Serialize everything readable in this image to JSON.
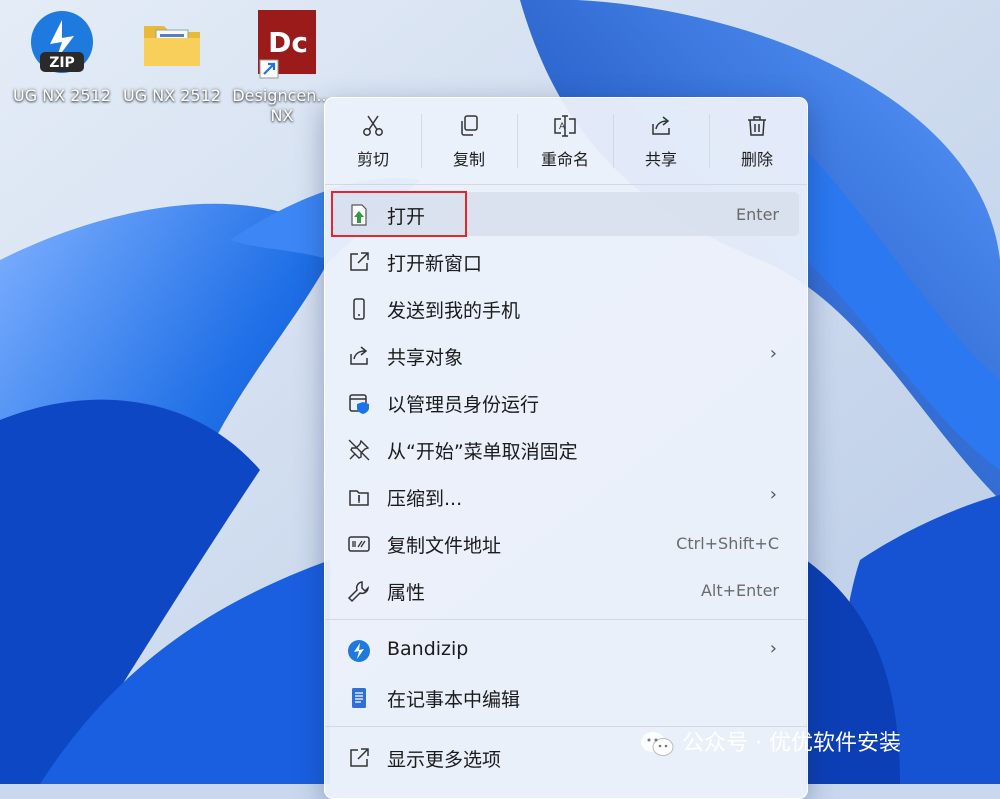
{
  "desktop": {
    "icons": [
      {
        "label": "UG NX 2512",
        "badge": "ZIP",
        "icon": "zip-archive-icon"
      },
      {
        "label": "UG NX 2512",
        "icon": "folder-icon"
      },
      {
        "label": "Designcen...\nNX",
        "badge": "Dc",
        "icon": "designcenter-shortcut-icon"
      }
    ]
  },
  "context_menu": {
    "toolbar": [
      {
        "label": "剪切",
        "icon": "scissors-icon"
      },
      {
        "label": "复制",
        "icon": "copy-icon"
      },
      {
        "label": "重命名",
        "icon": "rename-icon"
      },
      {
        "label": "共享",
        "icon": "share-icon"
      },
      {
        "label": "删除",
        "icon": "trash-icon"
      }
    ],
    "items": [
      {
        "label": "打开",
        "shortcut": "Enter",
        "icon": "open-file-icon",
        "highlighted": true
      },
      {
        "label": "打开新窗口",
        "icon": "open-new-window-icon"
      },
      {
        "label": "发送到我的手机",
        "icon": "phone-icon"
      },
      {
        "label": "共享对象",
        "icon": "share-icon",
        "submenu": "›"
      },
      {
        "label": "以管理员身份运行",
        "icon": "admin-shield-icon"
      },
      {
        "label": "从“开始”菜单取消固定",
        "icon": "unpin-icon"
      },
      {
        "label": "压缩到...",
        "icon": "compress-icon",
        "submenu": "›"
      },
      {
        "label": "复制文件地址",
        "shortcut": "Ctrl+Shift+C",
        "icon": "copy-path-icon"
      },
      {
        "label": "属性",
        "shortcut": "Alt+Enter",
        "icon": "wrench-icon"
      },
      {
        "label": "Bandizip",
        "icon": "bandizip-icon",
        "submenu": "›"
      },
      {
        "label": "在记事本中编辑",
        "icon": "notepad-icon"
      },
      {
        "label": "显示更多选项",
        "icon": "more-options-icon"
      }
    ]
  },
  "watermark": {
    "text": "公众号 · 优优软件安装",
    "icon": "wechat-icon"
  },
  "colors": {
    "accent": "#1a73e8",
    "highlight_border": "#e0282e",
    "wallpaper_blue": "#1f6fe6"
  }
}
